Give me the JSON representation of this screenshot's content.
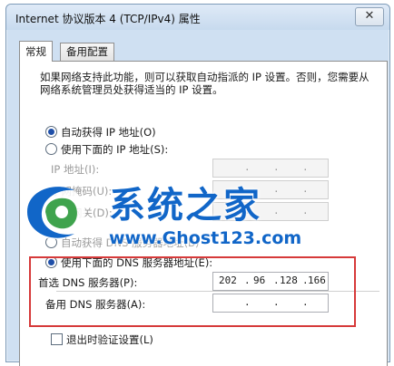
{
  "window": {
    "title": "Internet 协议版本 4 (TCP/IPv4) 属性",
    "close_glyph": "✕"
  },
  "tabs": [
    {
      "label": "常规"
    },
    {
      "label": "备用配置"
    }
  ],
  "description": "如果网络支持此功能，则可以获取自动指派的 IP 设置。否则，您需要从网络系统管理员处获得适当的 IP 设置。",
  "ip": {
    "auto_label": "自动获得 IP 地址(O)",
    "manual_label": "使用下面的 IP 地址(S):",
    "address_label": "IP 地址(I):",
    "mask_label": "子网掩码(U):",
    "gateway_label": "默认网关(D):"
  },
  "dns": {
    "auto_label": "自动获得 DNS 服务器地址(B)",
    "manual_label": "使用下面的 DNS 服务器地址(E):",
    "preferred_label": "首选 DNS 服务器(P):",
    "preferred_octets": [
      "202",
      "96",
      "128",
      "166"
    ],
    "alternate_label": "备用 DNS 服务器(A):"
  },
  "validate_label": "退出时验证设置(L)",
  "ip_separator": ".",
  "watermark": {
    "text": "系统之家",
    "url": "www.Ghost123.com"
  },
  "colors": {
    "accent": "#1f4fa8",
    "highlight": "#d63a3a",
    "watermark": "#1166c8"
  }
}
